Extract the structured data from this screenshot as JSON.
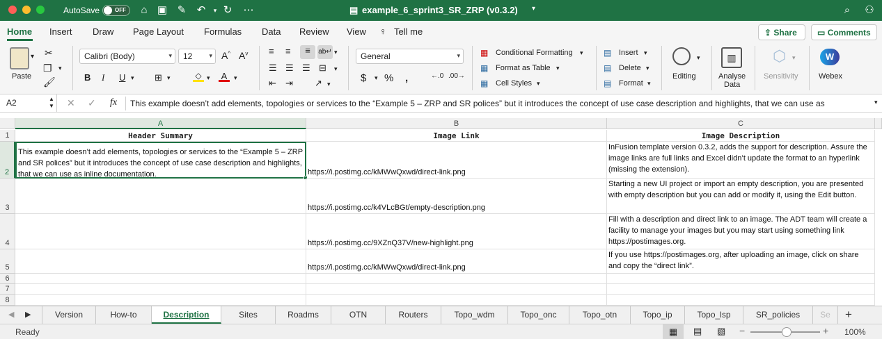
{
  "titlebar": {
    "autosave_label": "AutoSave",
    "autosave_state": "OFF",
    "document_title": "example_6_sprint3_SR_ZRP (v0.3.2)"
  },
  "ribbon_tabs": [
    "Home",
    "Insert",
    "Draw",
    "Page Layout",
    "Formulas",
    "Data",
    "Review",
    "View",
    "Tell me"
  ],
  "ribbon_actions": {
    "share": "Share",
    "comments": "Comments"
  },
  "ribbon": {
    "paste": "Paste",
    "font_name": "Calibri (Body)",
    "font_size": "12",
    "number_format": "General",
    "conditional_formatting": "Conditional Formatting",
    "format_as_table": "Format as Table",
    "cell_styles": "Cell Styles",
    "insert": "Insert",
    "delete": "Delete",
    "format": "Format",
    "editing": "Editing",
    "analyse_data_1": "Analyse",
    "analyse_data_2": "Data",
    "sensitivity": "Sensitivity",
    "webex": "Webex"
  },
  "formula_bar": {
    "cell_ref": "A2",
    "fx": "fx",
    "content": "This example doesn’t add elements, topologies or services to the “Example 5 – ZRP and SR polices” but it introduces the concept of use case description and highlights, that we can use as"
  },
  "columns": [
    "A",
    "B",
    "C"
  ],
  "rows": [
    "1",
    "2",
    "3",
    "4",
    "5",
    "6",
    "7",
    "8"
  ],
  "cells": {
    "A1": "Header Summary",
    "B1": "Image Link",
    "C1": "Image Description",
    "A2": "This example doesn’t add elements, topologies or services to the “Example 5 – ZRP and SR polices” but it introduces the concept of use case description and highlights, that we can use as inline documentation.",
    "B2": "https://i.postimg.cc/kMWwQxwd/direct-link.png",
    "C2": "InFusion template version 0.3.2, adds the support for description. Assure the image links are full links and Excel didn’t update the format to an hyperlink (missing the extension).",
    "B3": "https://i.postimg.cc/k4VLcBGt/empty-description.png",
    "C3": "Starting a new UI project or import an empty description, you are presented with empty description but you can add or modify it, using the Edit button.",
    "B4": "https://i.postimg.cc/9XZnQ37V/new-highlight.png",
    "C4": "Fill with a description and direct link to an image. The ADT team will create a facility to manage your images but you may start using something link https://postimages.org.",
    "B5": "https://i.postimg.cc/kMWwQxwd/direct-link.png",
    "C5": "If you use https://postimages.org, after uploading an image, click on share and copy the “direct link”."
  },
  "sheet_tabs": [
    "Version",
    "How-to",
    "Description",
    "Sites",
    "Roadms",
    "OTN",
    "Routers",
    "Topo_wdm",
    "Topo_onc",
    "Topo_otn",
    "Topo_ip",
    "Topo_lsp",
    "SR_policies",
    "Se"
  ],
  "active_sheet": "Description",
  "status": {
    "ready": "Ready",
    "zoom": "100%"
  },
  "colors": {
    "brand": "#1f7244",
    "active_cell_border": "#1f7244"
  }
}
